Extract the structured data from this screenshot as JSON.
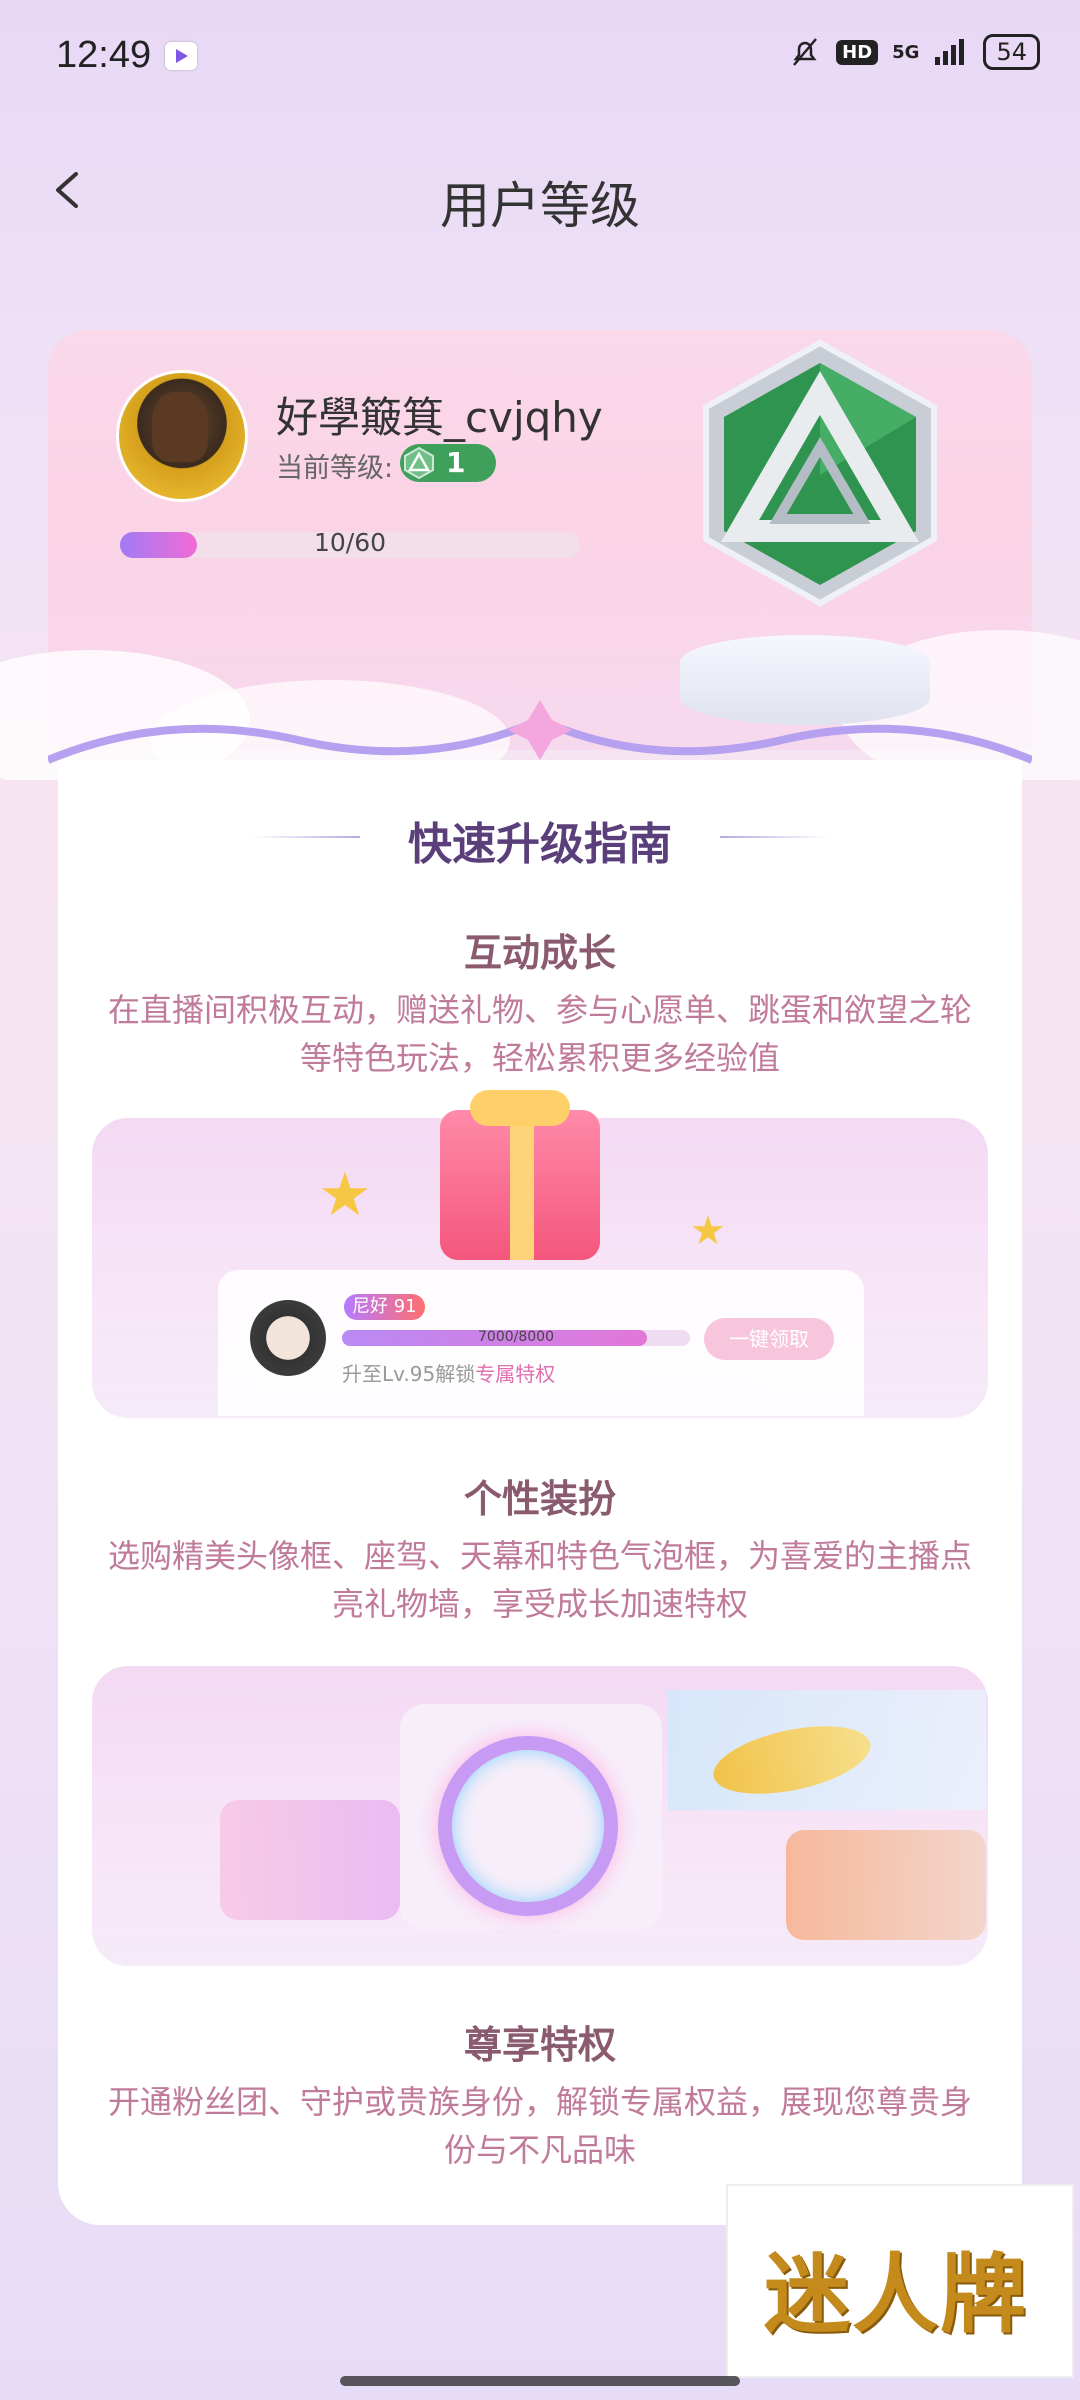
{
  "status_bar": {
    "time": "12:49",
    "hd": "HD",
    "network": "5G",
    "battery": "54"
  },
  "header": {
    "title": "用户等级"
  },
  "profile": {
    "username": "好學簸箕_cvjqhy",
    "level_label": "当前等级:",
    "level": "1",
    "progress_text": "10/60",
    "progress_fraction": 0.1667
  },
  "guide": {
    "title": "快速升级指南",
    "sections": [
      {
        "title": "互动成长",
        "desc": "在直播间积极互动，赠送礼物、参与心愿单、跳蛋和欲望之轮等特色玩法，轻松累积更多经验值"
      },
      {
        "title": "个性装扮",
        "desc": "选购精美头像框、座驾、天幕和特色气泡框，为喜爱的主播点亮礼物墙，享受成长加速特权"
      },
      {
        "title": "尊享特权",
        "desc": "开通粉丝团、守护或贵族身份，解锁专属权益，展现您尊贵身份与不凡品味"
      }
    ]
  },
  "illustration": {
    "nickname": "尼好 91",
    "bar_text": "7000/8000",
    "bar_fraction": 0.875,
    "unlock_prefix": "升至Lv.95解锁",
    "unlock_highlight": "专属特权",
    "claim_label": "一键领取"
  },
  "watermark": {
    "text": "迷人牌"
  },
  "colors": {
    "accent": "#f26bd5",
    "level_green": "#3fa05c",
    "title": "#5a3f7a"
  }
}
